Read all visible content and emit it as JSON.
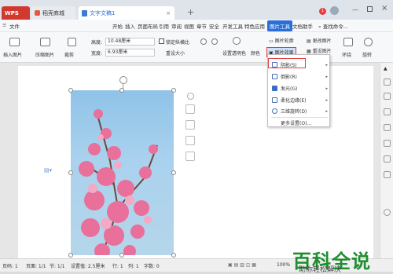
{
  "titlebar": {
    "app": "WPS",
    "tabs": [
      {
        "label": "稻壳商城"
      },
      {
        "label": "文字文稿1"
      }
    ],
    "new_tab": "+",
    "badge": "1"
  },
  "menubar": {
    "items": [
      "文件",
      "开始",
      "插入",
      "页面布局",
      "引用",
      "审阅",
      "视图",
      "章节",
      "安全",
      "开发工具",
      "特色应用",
      "图片工具",
      "文档助手"
    ],
    "search": "查找命令..."
  },
  "toolbar": {
    "insert_picture": "插入图片",
    "compress": "压缩图片",
    "crop": "裁剪",
    "height_label": "高度:",
    "height_value": "10.48厘米",
    "width_label": "宽度:",
    "width_value": "6.93厘米",
    "lock_ratio": "锁定纵横比",
    "reset_size": "重设大小",
    "set_transparent": "设置透明色",
    "color": "颜色",
    "outline": "图片轮廓",
    "effects": "图片效果",
    "change_picture": "更改图片",
    "reset_picture": "重设图片",
    "wrap": "环绕",
    "rotate": "旋转"
  },
  "dropdown": {
    "items": [
      {
        "label": "阴影(S)",
        "has_arrow": true
      },
      {
        "label": "倒影(R)",
        "has_arrow": true
      },
      {
        "label": "发光(G)",
        "has_arrow": true
      },
      {
        "label": "柔化边缘(E)",
        "has_arrow": true
      },
      {
        "label": "三维旋转(D)",
        "has_arrow": true
      }
    ],
    "more": "更多设置(O)..."
  },
  "statusbar": {
    "page": "页码: 1",
    "pages": "页面: 1/1",
    "section": "节: 1/1",
    "setting": "设置值: 2.5厘米",
    "row": "行: 1",
    "col": "列: 1",
    "words": "字数: 0",
    "zoom": "100%"
  },
  "watermark": {
    "title": "百科全说",
    "subtitle": "助你轻松解决"
  },
  "colors": {
    "accent": "#2b6fd6",
    "highlight": "#e04040",
    "watermark": "#1e8e2e"
  }
}
